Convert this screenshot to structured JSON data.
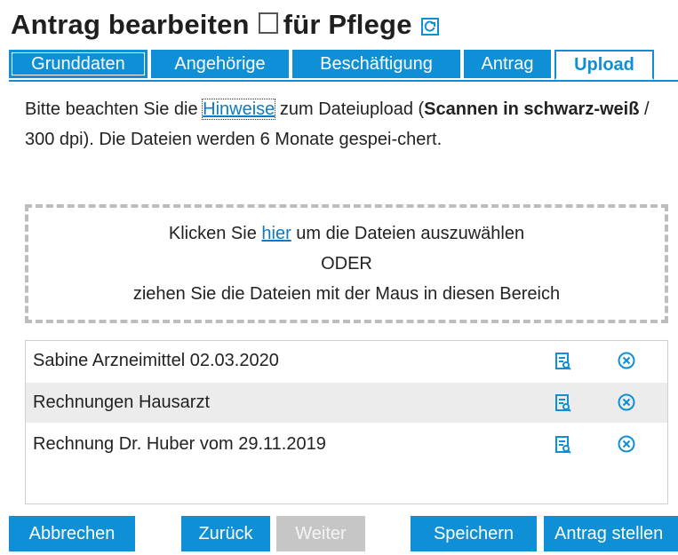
{
  "header": {
    "title_part1": "Antrag bearbeiten",
    "title_part2": "für Pflege",
    "icon": "refresh-icon",
    "accent_color": "#0e8fd6"
  },
  "tabs": [
    {
      "label": "Grunddaten",
      "active": false
    },
    {
      "label": "Angehörige",
      "active": false
    },
    {
      "label": "Beschäftigung",
      "active": false
    },
    {
      "label": "Antrag",
      "active": false
    },
    {
      "label": "Upload",
      "active": true
    }
  ],
  "info": {
    "text_before_link": "Bitte beachten Sie die ",
    "link_label": "Hinweise",
    "text_after_link": " zum Dateiupload (",
    "bold_text": "Scannen in schwarz-weiß",
    "text_end": " / 300 dpi). Die Dateien werden 6 Monate gespei-chert."
  },
  "dropzone": {
    "line1_before": "Klicken Sie ",
    "line1_link": "hier",
    "line1_after": " um die Dateien auszuwählen",
    "line2": "ODER",
    "line3": "ziehen Sie die Dateien mit der Maus in diesen Bereich"
  },
  "files": [
    {
      "name": "Sabine Arzneimittel 02.03.2020",
      "view_icon": "document-preview-icon",
      "delete_icon": "remove-circle-icon"
    },
    {
      "name": "Rechnungen Hausarzt",
      "view_icon": "document-preview-icon",
      "delete_icon": "remove-circle-icon"
    },
    {
      "name": "Rechnung Dr. Huber vom 29.11.2019",
      "view_icon": "document-preview-icon",
      "delete_icon": "remove-circle-icon"
    }
  ],
  "buttons": {
    "cancel": "Abbrechen",
    "back": "Zurück",
    "next": "Weiter",
    "save": "Speichern",
    "submit": "Antrag stellen"
  }
}
